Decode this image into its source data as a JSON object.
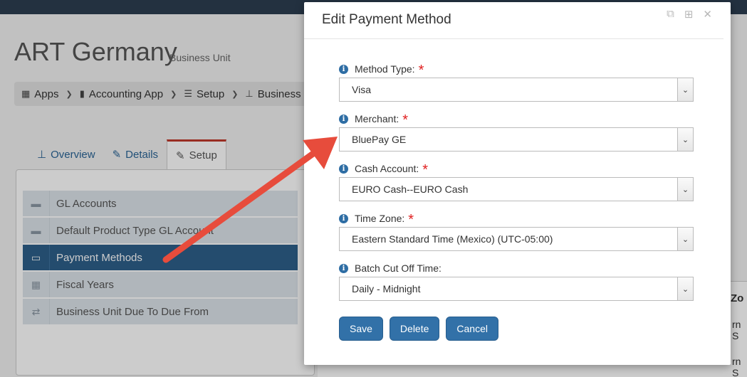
{
  "page": {
    "title": "ART Germany",
    "subtitle": "Business Unit",
    "breadcrumb": [
      {
        "label": "Apps",
        "icon": "grid-icon"
      },
      {
        "label": "Accounting App",
        "icon": "book-icon"
      },
      {
        "label": "Setup",
        "icon": "list-icon"
      },
      {
        "label": "Business",
        "icon": "sitemap-icon"
      }
    ],
    "tabs": [
      {
        "label": "Overview",
        "icon": "sitemap-icon"
      },
      {
        "label": "Details",
        "icon": "edit-icon"
      },
      {
        "label": "Setup",
        "icon": "edit-icon",
        "active": true
      }
    ],
    "side_items": [
      {
        "label": "GL Accounts",
        "icon": "money-icon"
      },
      {
        "label": "Default Product Type GL Account",
        "icon": "money-icon"
      },
      {
        "label": "Payment Methods",
        "icon": "credit-card-icon",
        "active": true
      },
      {
        "label": "Fiscal Years",
        "icon": "calendar-icon"
      },
      {
        "label": "Business Unit Due To Due From",
        "icon": "exchange-icon"
      }
    ],
    "table_fragment": {
      "header": "Zo",
      "cells": [
        "rn S",
        "rn S"
      ]
    }
  },
  "modal": {
    "title": "Edit Payment Method",
    "header_icons": [
      "external-edit-icon",
      "maximize-icon",
      "close-icon"
    ],
    "fields": [
      {
        "label": "Method Type:",
        "required": true,
        "value": "Visa"
      },
      {
        "label": "Merchant:",
        "required": true,
        "value": "BluePay GE"
      },
      {
        "label": "Cash Account:",
        "required": true,
        "value": "EURO Cash--EURO Cash"
      },
      {
        "label": "Time Zone:",
        "required": true,
        "value": "Eastern Standard Time (Mexico) (UTC-05:00)"
      },
      {
        "label": "Batch Cut Off Time:",
        "required": false,
        "value": "Daily - Midnight"
      }
    ],
    "buttons": {
      "save": "Save",
      "delete": "Delete",
      "cancel": "Cancel"
    }
  },
  "colors": {
    "primary": "#3271a8",
    "active_tab_accent": "#c0392b",
    "active_side_item": "#2e5f8a",
    "required_star": "#e02020",
    "annotation_arrow": "#e74c3c"
  }
}
